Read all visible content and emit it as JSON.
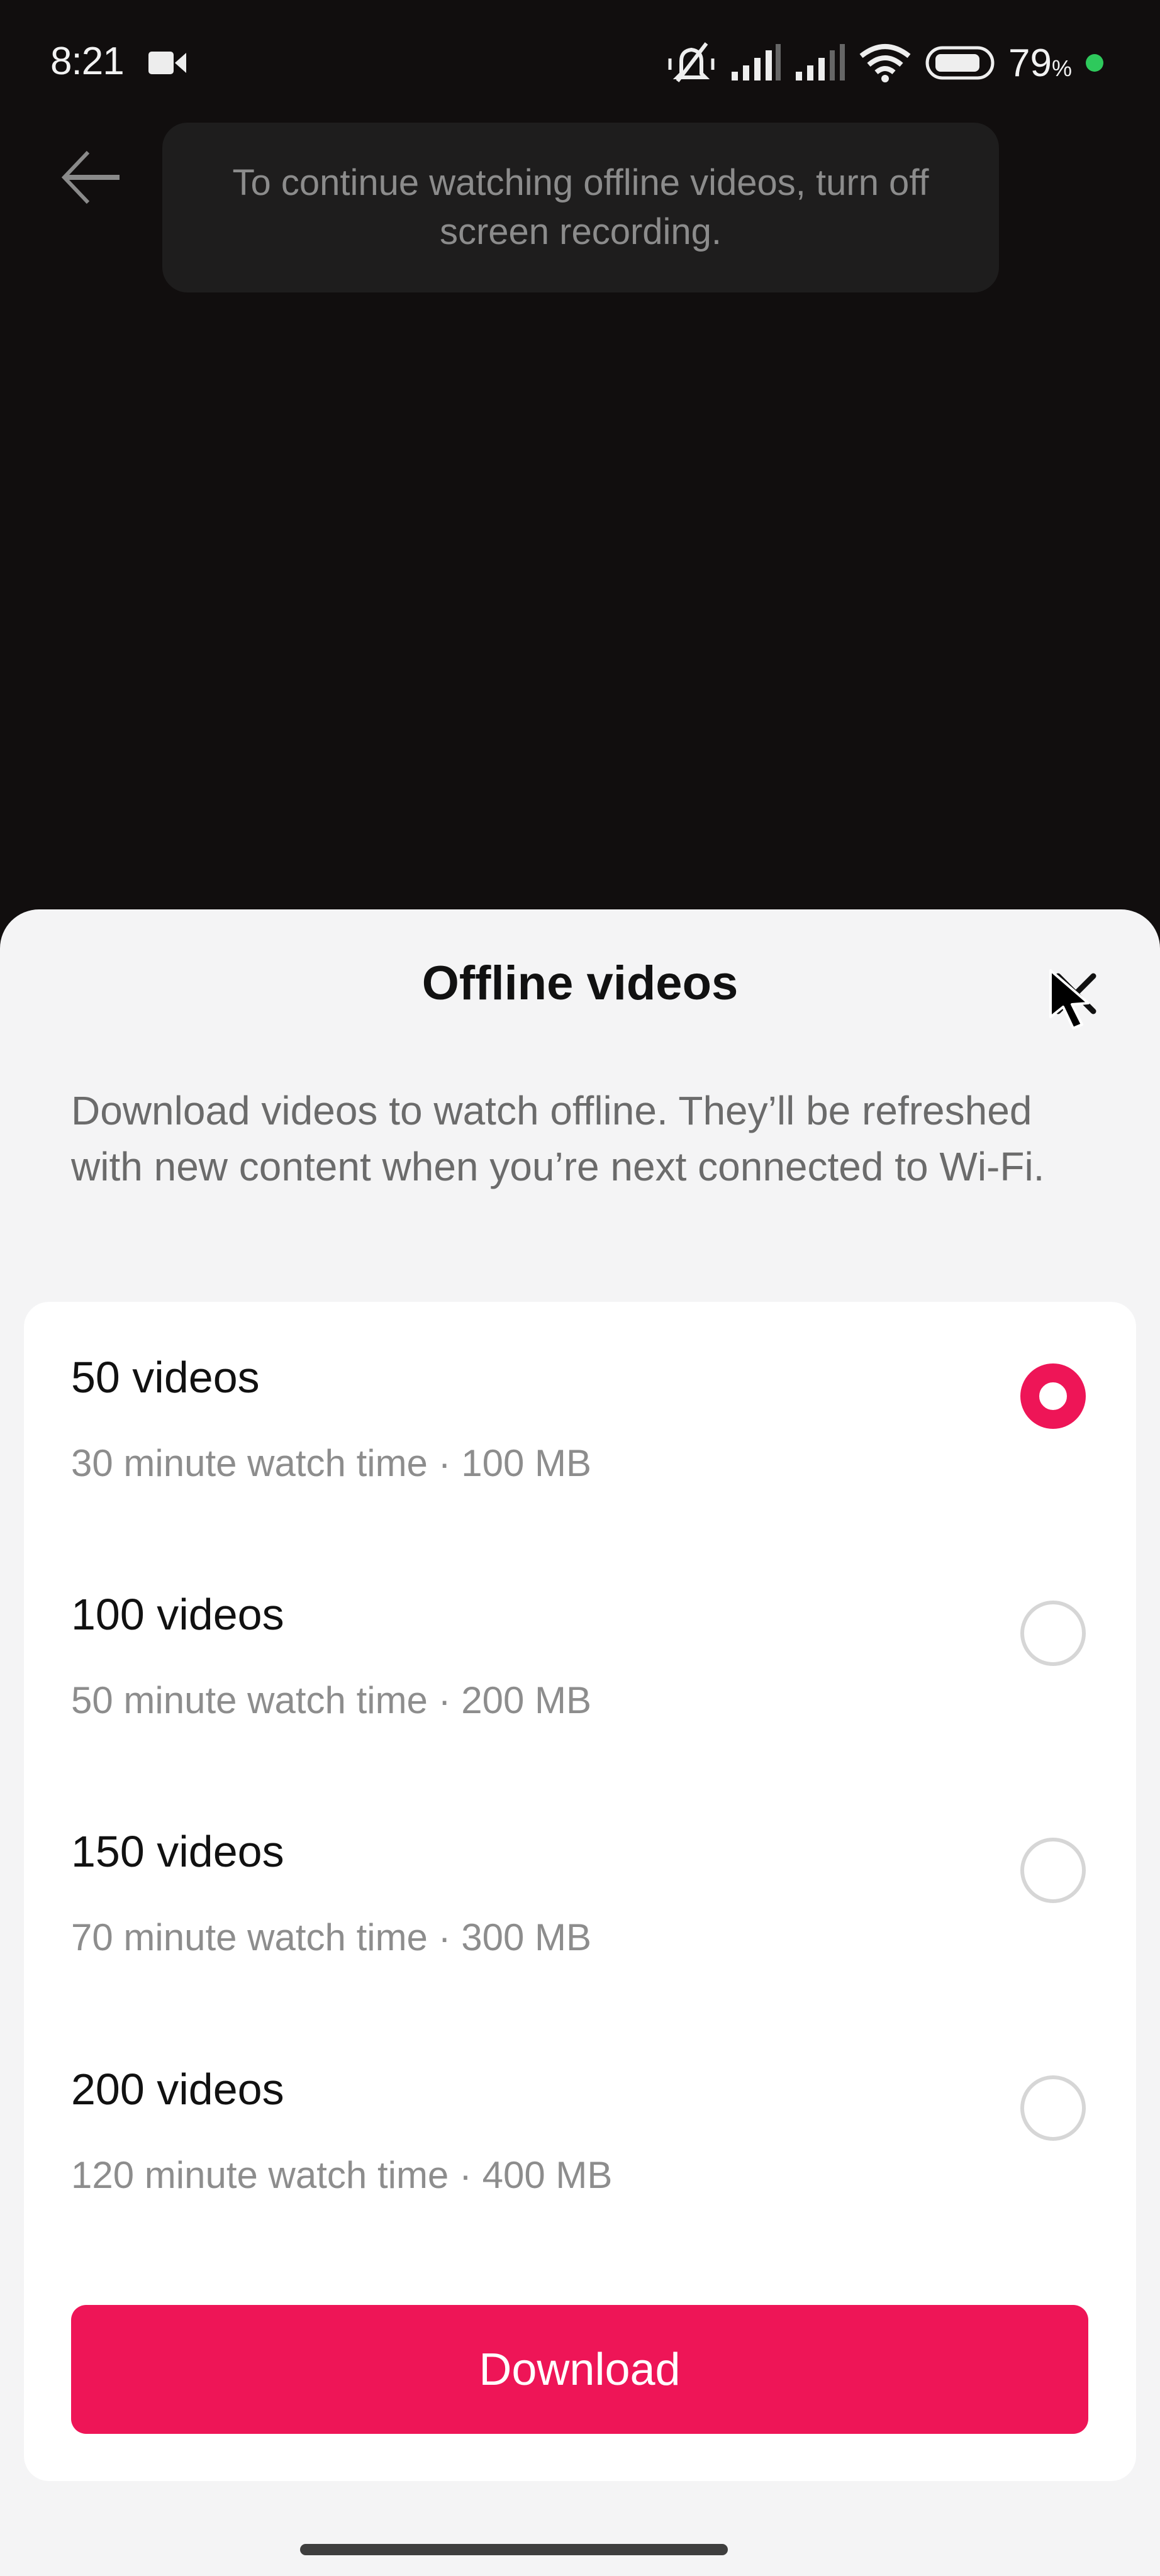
{
  "status_bar": {
    "time": "8:21",
    "battery_percent": "79",
    "battery_unit": "%",
    "icons": [
      "screen-record-icon",
      "silent-bell-icon",
      "signal-icon",
      "signal-icon",
      "wifi-icon",
      "battery-icon",
      "charging-dot"
    ],
    "charging_color": "#2ec95c"
  },
  "background_screen": {
    "back_icon": "arrow-left-icon",
    "toast_message": "To continue watching offline videos, turn off screen recording."
  },
  "sheet": {
    "title": "Offline videos",
    "close_icon": "close-icon",
    "description": "Download videos to watch offline. They’ll be refreshed with new content when you’re next connected to Wi-Fi.",
    "options": [
      {
        "label": "50 videos",
        "detail": "30 minute watch time · 100 MB",
        "selected": true
      },
      {
        "label": "100 videos",
        "detail": "50 minute watch time · 200 MB",
        "selected": false
      },
      {
        "label": "150 videos",
        "detail": "70 minute watch time · 300 MB",
        "selected": false
      },
      {
        "label": "200 videos",
        "detail": "120 minute watch time · 400 MB",
        "selected": false
      }
    ],
    "primary_button": "Download",
    "accent_color": "#ee1557"
  }
}
